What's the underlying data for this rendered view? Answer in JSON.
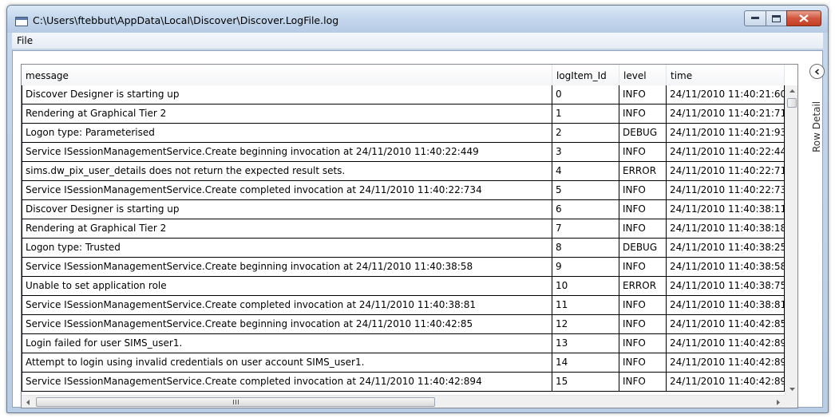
{
  "window": {
    "title": "C:\\Users\\ftebbut\\AppData\\Local\\Discover\\Discover.LogFile.log"
  },
  "menu": {
    "items": [
      {
        "label": "File"
      }
    ]
  },
  "grid": {
    "columns": [
      "message",
      "logItem_Id",
      "level",
      "time"
    ],
    "rows": [
      {
        "message": "Discover Designer is starting up",
        "id": "0",
        "level": "INFO",
        "time": "24/11/2010 11:40:21:60"
      },
      {
        "message": "Rendering at Graphical Tier 2",
        "id": "1",
        "level": "INFO",
        "time": "24/11/2010 11:40:21:71"
      },
      {
        "message": "Logon type: Parameterised",
        "id": "2",
        "level": "DEBUG",
        "time": "24/11/2010 11:40:21:93"
      },
      {
        "message": "Service ISessionManagementService.Create beginning invocation at 24/11/2010 11:40:22:449",
        "id": "3",
        "level": "INFO",
        "time": "24/11/2010 11:40:22:44"
      },
      {
        "message": "sims.dw_pix_user_details does not return the expected result sets.",
        "id": "4",
        "level": "ERROR",
        "time": "24/11/2010 11:40:22:71"
      },
      {
        "message": "Service ISessionManagementService.Create completed invocation at 24/11/2010 11:40:22:734",
        "id": "5",
        "level": "INFO",
        "time": "24/11/2010 11:40:22:73"
      },
      {
        "message": "Discover Designer is starting up",
        "id": "6",
        "level": "INFO",
        "time": "24/11/2010 11:40:38:11"
      },
      {
        "message": "Rendering at Graphical Tier 2",
        "id": "7",
        "level": "INFO",
        "time": "24/11/2010 11:40:38:18"
      },
      {
        "message": "Logon type: Trusted",
        "id": "8",
        "level": "DEBUG",
        "time": "24/11/2010 11:40:38:25"
      },
      {
        "message": "Service ISessionManagementService.Create beginning invocation at 24/11/2010 11:40:38:58",
        "id": "9",
        "level": "INFO",
        "time": "24/11/2010 11:40:38:58"
      },
      {
        "message": "Unable to set application role",
        "id": "10",
        "level": "ERROR",
        "time": "24/11/2010 11:40:38:75"
      },
      {
        "message": "Service ISessionManagementService.Create completed invocation at 24/11/2010 11:40:38:81",
        "id": "11",
        "level": "INFO",
        "time": "24/11/2010 11:40:38:81"
      },
      {
        "message": "Service ISessionManagementService.Create beginning invocation at 24/11/2010 11:40:42:85",
        "id": "12",
        "level": "INFO",
        "time": "24/11/2010 11:40:42:85"
      },
      {
        "message": "Login failed for user SIMS_user1.",
        "id": "13",
        "level": "INFO",
        "time": "24/11/2010 11:40:42:89"
      },
      {
        "message": "Attempt to login using invalid credentials on user account SIMS_user1.",
        "id": "14",
        "level": "INFO",
        "time": "24/11/2010 11:40:42:89"
      },
      {
        "message": "Service ISessionManagementService.Create completed invocation at 24/11/2010 11:40:42:894",
        "id": "15",
        "level": "INFO",
        "time": "24/11/2010 11:40:42:89"
      }
    ]
  },
  "side_panel": {
    "label": "Row Detail"
  }
}
